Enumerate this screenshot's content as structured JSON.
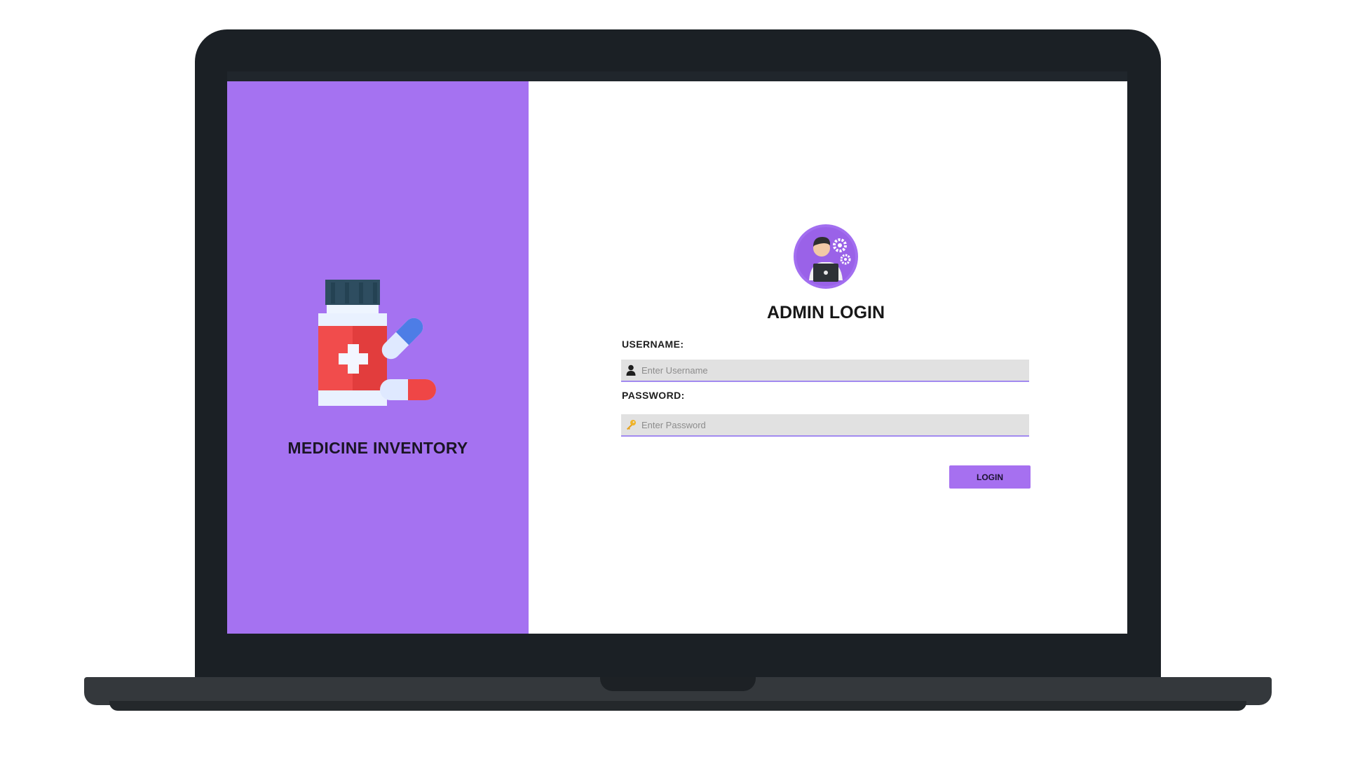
{
  "brand": {
    "title": "MEDICINE INVENTORY",
    "illustration_icon": "medicine-bottle-pills-icon"
  },
  "login": {
    "avatar_icon": "admin-avatar-icon",
    "title": "ADMIN LOGIN",
    "username": {
      "label": "USERNAME:",
      "placeholder": "Enter Username",
      "value": "",
      "icon": "user-icon"
    },
    "password": {
      "label": "PASSWORD:",
      "placeholder": "Enter Password",
      "value": "",
      "icon": "key-icon"
    },
    "button_label": "LOGIN"
  },
  "colors": {
    "brand_panel": "#a572f1",
    "accent": "#a670f0",
    "input_background": "#e1e1e1",
    "input_underline": "#a28af0",
    "laptop_frame": "#1b2025"
  }
}
